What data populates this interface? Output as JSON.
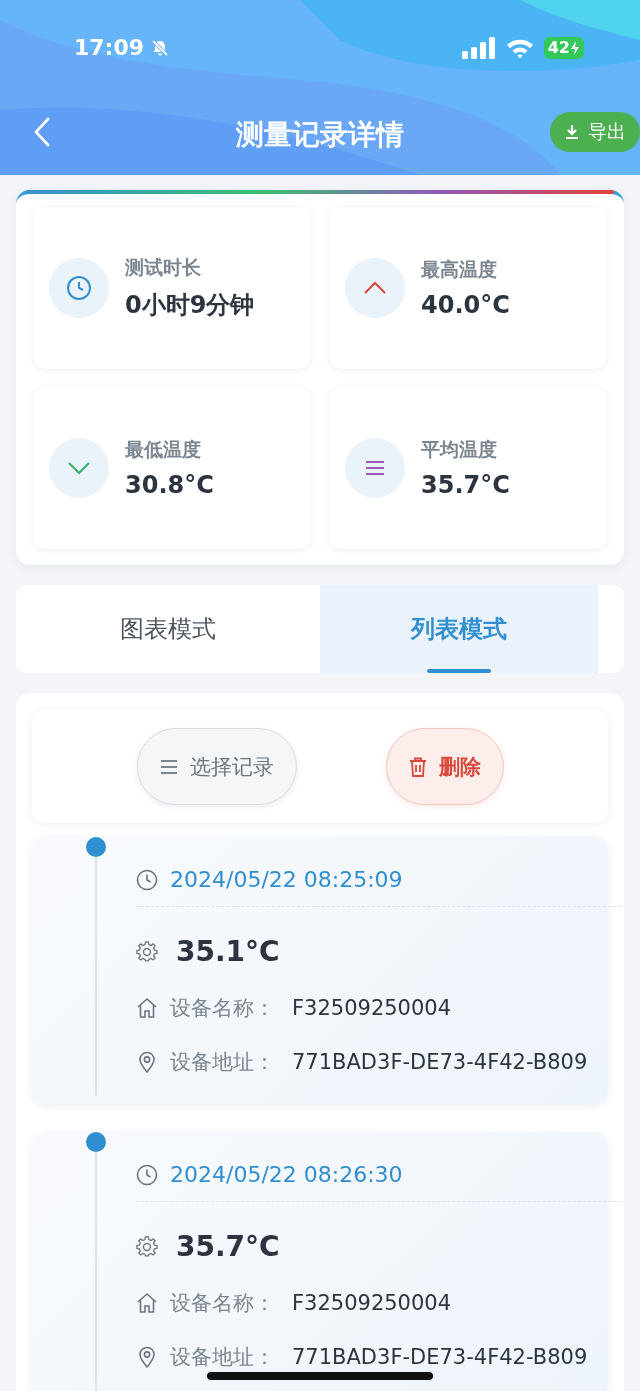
{
  "status_bar": {
    "time": "17:09",
    "battery": "42"
  },
  "header": {
    "title": "测量记录详情",
    "export_button": "导出"
  },
  "stats": [
    {
      "kind": "duration",
      "label": "测试时长",
      "value": "0小时9分钟"
    },
    {
      "kind": "max",
      "label": "最高温度",
      "value": "40.0°C"
    },
    {
      "kind": "min",
      "label": "最低温度",
      "value": "30.8°C"
    },
    {
      "kind": "avg",
      "label": "平均温度",
      "value": "35.7°C"
    }
  ],
  "tabs": [
    {
      "label": "图表模式",
      "selected": false
    },
    {
      "label": "列表模式",
      "selected": true
    }
  ],
  "toolbar": {
    "select_button": "选择记录",
    "delete_button": "删除"
  },
  "records": [
    {
      "time": "2024/05/22 08:25:09",
      "temperature": "35.1°C",
      "name_label": "设备名称：",
      "name": "F32509250004",
      "address_label": "设备地址：",
      "address": "771BAD3F-DE73-4F42-B809"
    },
    {
      "time": "2024/05/22 08:26:30",
      "temperature": "35.7°C",
      "name_label": "设备名称：",
      "name": "F32509250004",
      "address_label": "设备地址：",
      "address": "771BAD3F-DE73-4F42-B809"
    }
  ]
}
